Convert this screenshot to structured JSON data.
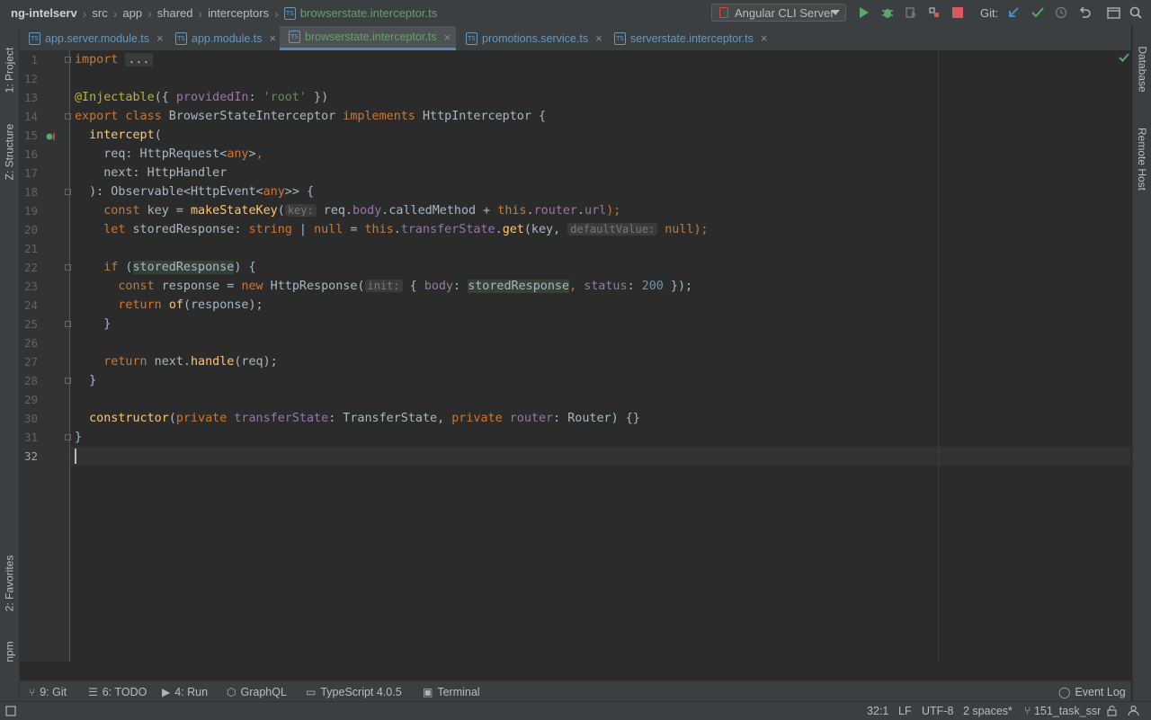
{
  "navbar": {
    "breadcrumbs": [
      "ng-intelserv",
      "src",
      "app",
      "shared",
      "interceptors",
      "browserstate.interceptor.ts"
    ],
    "run_config": "Angular CLI Server",
    "git_label": "Git:"
  },
  "tabs": [
    {
      "label": "app.server.module.ts",
      "active": false
    },
    {
      "label": "app.module.ts",
      "active": false
    },
    {
      "label": "browserstate.interceptor.ts",
      "active": true
    },
    {
      "label": "promotions.service.ts",
      "active": false
    },
    {
      "label": "serverstate.interceptor.ts",
      "active": false
    }
  ],
  "left_tools": {
    "project": "1: Project",
    "structure": "Z: Structure",
    "favorites": "2: Favorites",
    "npm": "npm"
  },
  "right_tools": {
    "database": "Database",
    "remote_host": "Remote Host"
  },
  "editor": {
    "line_numbers": [
      "1",
      "12",
      "13",
      "14",
      "15",
      "16",
      "17",
      "18",
      "19",
      "20",
      "21",
      "22",
      "23",
      "24",
      "25",
      "26",
      "27",
      "28",
      "29",
      "30",
      "31",
      "32"
    ],
    "code": {
      "import_kw": "import",
      "import_fold": "...",
      "injectable_ann": "@Injectable",
      "injectable_open": "({ ",
      "provided_in": "providedIn",
      "colon": ": ",
      "root_str": "'root'",
      "injectable_close": " })",
      "export_kw": "export class",
      "class_name": " BrowserStateInterceptor ",
      "implements_kw": "implements",
      "iface": " HttpInterceptor {",
      "intercept_fn": "intercept",
      "open_paren": "(",
      "req_decl": "req: HttpRequest<",
      "any1": "any",
      "req_close": ">",
      "comma": ",",
      "next_decl": "next: HttpHandler",
      "ret_open": "): Observable<HttpEvent<",
      "any2": "any",
      "ret_close": ">> {",
      "const_kw": "const",
      "key_assign": " key = ",
      "make_state_key": "makeStateKey",
      "hint_key": "key:",
      "req_dot": " req.",
      "body_fld": "body",
      "called_method": ".calledMethod + ",
      "this_kw": "this",
      "router_fld": "router",
      "url_fld": "url",
      "close_semi": ");",
      "let_kw": "let",
      "stored_decl": " storedResponse: ",
      "string_kw": "string",
      "pipe": " | ",
      "null_kw": "null",
      "assign": " = ",
      "transfer_fld": "transferState",
      "get_fn": "get",
      "key_arg": "(key, ",
      "hint_default": "defaultValue:",
      "if_kw": "if",
      "if_open": " (",
      "stored_var": "storedResponse",
      "if_close": ") {",
      "response_assign": " response = ",
      "new_kw": "new",
      "http_response": " HttpResponse(",
      "hint_init": "init:",
      "obj_open": " { ",
      "body_key": "body",
      "status_key": "status",
      "status_val": "200",
      "obj_close": " });",
      "return_kw": "return",
      "of_fn": "of",
      "of_args": "(response);",
      "brace_close": "}",
      "next_dot": " next.",
      "handle_fn": "handle",
      "handle_args": "(req);",
      "constructor_kw": "constructor",
      "private_kw": "private",
      "transfer_param": "transferState",
      "transfer_type": ": TransferState, ",
      "router_param": "router",
      "router_type": ": Router) {}"
    }
  },
  "bottom_tools": {
    "git": "9: Git",
    "todo": "6: TODO",
    "run": "4: Run",
    "graphql": "GraphQL",
    "typescript": "TypeScript 4.0.5",
    "terminal": "Terminal",
    "event_log": "Event Log"
  },
  "status": {
    "position": "32:1",
    "line_sep": "LF",
    "encoding": "UTF-8",
    "indent": "2 spaces*",
    "branch": "151_task_ssr"
  },
  "colors": {
    "accent": "#4a88c7",
    "keyword": "#cc7832",
    "function": "#ffc66d",
    "string": "#6a8759"
  }
}
